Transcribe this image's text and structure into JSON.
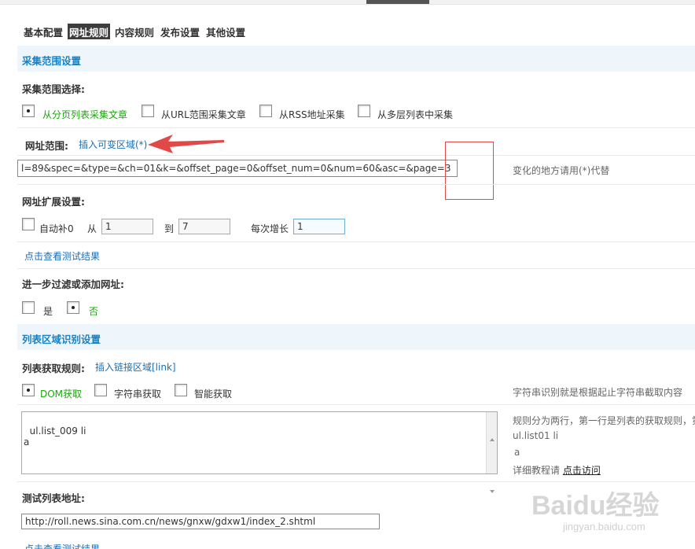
{
  "tabs": [
    {
      "label": "基本配置",
      "active": false
    },
    {
      "label": "网址规则",
      "active": true
    },
    {
      "label": "内容规则",
      "active": false
    },
    {
      "label": "发布设置",
      "active": false
    },
    {
      "label": "其他设置",
      "active": false
    }
  ],
  "collect_range": {
    "header": "采集范围设置",
    "choose_label": "采集范围选择:",
    "options": [
      {
        "label": "从分页列表采集文章",
        "selected": true
      },
      {
        "label": "从URL范围采集文章",
        "selected": false
      },
      {
        "label": "从RSS地址采集",
        "selected": false
      },
      {
        "label": "从多层列表中采集",
        "selected": false
      }
    ],
    "url_range_label": "网址范围:",
    "insert_variable_link": "插入可变区域(*)",
    "url_value": "l=89&spec=&type=&ch=01&k=&offset_page=0&offset_num=0&num=60&asc=&page=3",
    "url_hint": "变化的地方请用(*)代替",
    "ext_label": "网址扩展设置:",
    "auto_zero_label": "自动补0",
    "from_label": "从",
    "from_value": "1",
    "to_label": "到",
    "to_value": "7",
    "step_label": "每次增长",
    "step_value": "1",
    "test_link": "点击查看测试结果",
    "filter_label": "进一步过滤或添加网址:",
    "filter_options": [
      {
        "label": "是",
        "selected": false
      },
      {
        "label": "否",
        "selected": true
      }
    ]
  },
  "list_area": {
    "header": "列表区域识别设置",
    "rule_label": "列表获取规则:",
    "insert_link": "插入链接区域[link]",
    "modes": [
      {
        "label": "DOM获取",
        "selected": true
      },
      {
        "label": "字符串获取",
        "selected": false
      },
      {
        "label": "智能获取",
        "selected": false
      }
    ],
    "rule_text": "ul.list_009 li\na",
    "hint_line1": "字符串识别就是根据起止字符串截取内容",
    "hint_line2": "规则分为两行，第一行是列表的获取规则，第",
    "hint_line3": "ul.list01 li",
    "hint_line4": "a",
    "hint_tutorial": "详细教程请",
    "hint_tutorial_link": "点击访问",
    "test_url_label": "测试列表地址:",
    "test_url_value": "http://roll.news.sina.com.cn/news/gnxw/gdxw1/index_2.shtml",
    "bottom_link": "点击查看测试结果"
  },
  "watermark": {
    "text": "Baidu经验",
    "sub": "jingyan.baidu.com"
  },
  "colors": {
    "header_bg": "#eef5fb",
    "header_text": "#1a82c4",
    "link": "#1a6fb8",
    "selected_option": "#1aa60a",
    "annotation": "#e14848"
  }
}
